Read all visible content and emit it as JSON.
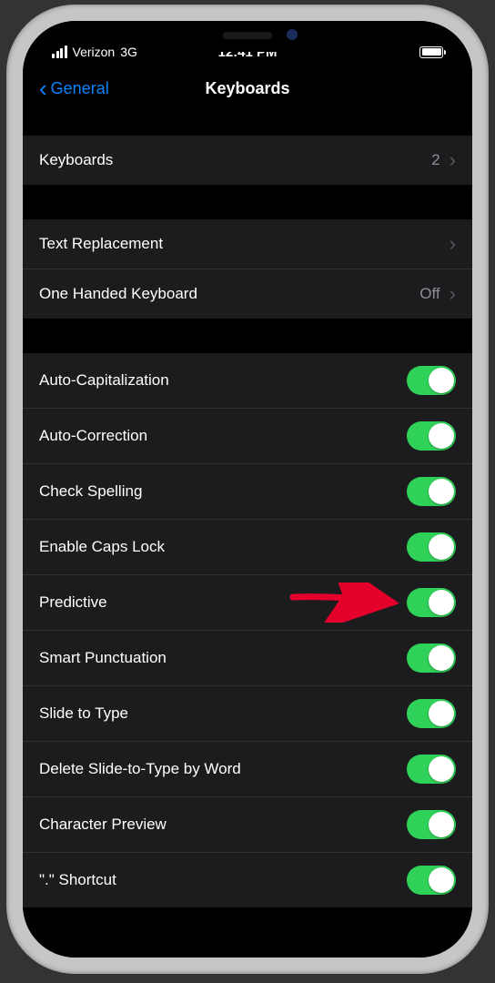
{
  "statusBar": {
    "carrier": "Verizon",
    "network": "3G",
    "time": "12:41 PM"
  },
  "nav": {
    "back": "General",
    "title": "Keyboards"
  },
  "groups": [
    {
      "rows": [
        {
          "label": "Keyboards",
          "value": "2",
          "chevron": true
        }
      ]
    },
    {
      "rows": [
        {
          "label": "Text Replacement",
          "value": "",
          "chevron": true
        },
        {
          "label": "One Handed Keyboard",
          "value": "Off",
          "chevron": true
        }
      ]
    },
    {
      "rows": [
        {
          "label": "Auto-Capitalization",
          "toggle": true
        },
        {
          "label": "Auto-Correction",
          "toggle": true
        },
        {
          "label": "Check Spelling",
          "toggle": true
        },
        {
          "label": "Enable Caps Lock",
          "toggle": true
        },
        {
          "label": "Predictive",
          "toggle": true,
          "highlight": true
        },
        {
          "label": "Smart Punctuation",
          "toggle": true
        },
        {
          "label": "Slide to Type",
          "toggle": true
        },
        {
          "label": "Delete Slide-to-Type by Word",
          "toggle": true
        },
        {
          "label": "Character Preview",
          "toggle": true
        },
        {
          "label": "\".\" Shortcut",
          "toggle": true
        }
      ]
    }
  ],
  "colors": {
    "accent": "#0a84ff",
    "toggleOn": "#30d158",
    "arrow": "#e4002b"
  }
}
